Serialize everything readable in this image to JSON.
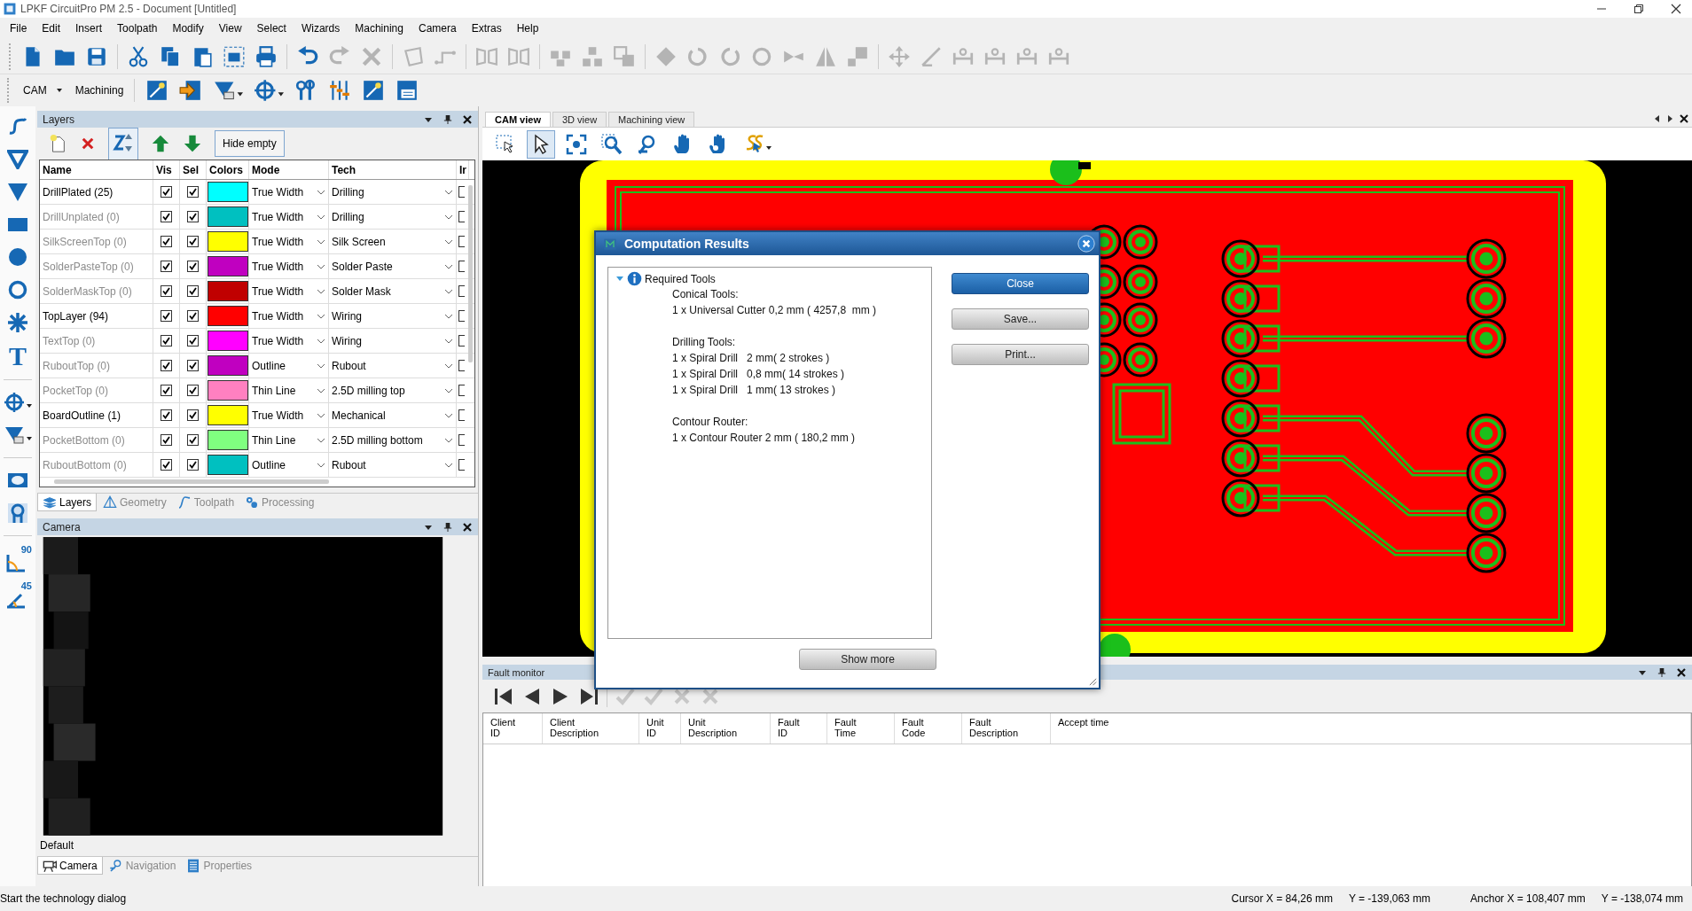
{
  "window": {
    "title": "LPKF CircuitPro PM 2.5 - Document [Untitled]"
  },
  "menu": [
    "File",
    "Edit",
    "Insert",
    "Toolpath",
    "Modify",
    "View",
    "Select",
    "Wizards",
    "Machining",
    "Camera",
    "Extras",
    "Help"
  ],
  "toolbar": [
    {
      "disabled": false
    },
    {
      "disabled": false
    },
    {
      "disabled": false
    },
    {
      "disabled": false
    },
    {
      "disabled": false
    },
    {
      "disabled": false
    },
    {
      "disabled": false
    },
    {
      "disabled": false
    },
    {
      "disabled": false
    },
    {
      "disabled": true
    },
    {
      "disabled": true
    },
    {
      "disabled": true
    },
    {
      "disabled": true
    },
    {
      "disabled": true
    },
    {
      "disabled": true
    },
    {
      "disabled": true
    },
    {
      "disabled": true
    },
    {
      "disabled": true
    },
    {
      "disabled": true
    },
    {
      "disabled": true
    },
    {
      "disabled": true
    },
    {
      "disabled": true
    },
    {
      "disabled": true
    },
    {
      "disabled": true
    },
    {
      "disabled": true
    },
    {
      "disabled": true
    },
    {
      "disabled": true
    },
    {
      "disabled": true
    },
    {
      "disabled": true
    },
    {
      "disabled": true
    },
    {
      "disabled": true
    }
  ],
  "toolbar2": {
    "mode": "CAM",
    "label": "Machining",
    "buttons": [
      {
        "disabled": false
      },
      {
        "disabled": false
      },
      {
        "disabled": false
      },
      {
        "disabled": false
      },
      {
        "disabled": false
      },
      {
        "disabled": false
      },
      {
        "disabled": false
      },
      {
        "disabled": false
      }
    ]
  },
  "tool_strip": {
    "text_glyph": "T",
    "angle_labels": [
      "90",
      "45"
    ]
  },
  "layers_panel": {
    "title": "Layers",
    "sort_active": true,
    "hide_empty": "Hide empty",
    "columns": [
      "Name",
      "Vis",
      "Sel",
      "Colors",
      "Mode",
      "Tech",
      "Ir"
    ],
    "rows": [
      {
        "name": "DrillPlated (25)",
        "empty": false,
        "vis": true,
        "sel": true,
        "color": "#00ffff",
        "mode": "True Width",
        "tech": "Drilling",
        "column_7": false
      },
      {
        "name": "DrillUnplated (0)",
        "empty": true,
        "vis": true,
        "sel": true,
        "color": "#00c0c0",
        "mode": "True Width",
        "tech": "Drilling",
        "column_7": false
      },
      {
        "name": "SilkScreenTop (0)",
        "empty": true,
        "vis": true,
        "sel": true,
        "color": "#ffff00",
        "mode": "True Width",
        "tech": "Silk Screen",
        "column_7": false
      },
      {
        "name": "SolderPasteTop (0)",
        "empty": true,
        "vis": true,
        "sel": true,
        "color": "#c000c0",
        "mode": "True Width",
        "tech": "Solder Paste",
        "column_7": false
      },
      {
        "name": "SolderMaskTop (0)",
        "empty": true,
        "vis": true,
        "sel": true,
        "color": "#c00000",
        "mode": "True Width",
        "tech": "Solder Mask",
        "column_7": false
      },
      {
        "name": "TopLayer (94)",
        "empty": false,
        "vis": true,
        "sel": true,
        "color": "#ff0000",
        "mode": "True Width",
        "tech": "Wiring",
        "column_7": false
      },
      {
        "name": "TextTop (0)",
        "empty": true,
        "vis": true,
        "sel": true,
        "color": "#ff00ff",
        "mode": "True Width",
        "tech": "Wiring",
        "column_7": false
      },
      {
        "name": "RuboutTop (0)",
        "empty": true,
        "vis": true,
        "sel": true,
        "color": "#c000c0",
        "mode": "Outline",
        "tech": "Rubout",
        "column_7": false
      },
      {
        "name": "PocketTop (0)",
        "empty": true,
        "vis": true,
        "sel": true,
        "color": "#ff80c0",
        "mode": "Thin Line",
        "tech": "2.5D milling top",
        "column_7": false
      },
      {
        "name": "BoardOutline (1)",
        "empty": false,
        "vis": true,
        "sel": true,
        "color": "#ffff00",
        "mode": "True Width",
        "tech": "Mechanical",
        "column_7": false
      },
      {
        "name": "PocketBottom (0)",
        "empty": true,
        "vis": true,
        "sel": true,
        "color": "#80ff80",
        "mode": "Thin Line",
        "tech": "2.5D milling bottom",
        "column_7": false
      },
      {
        "name": "RuboutBottom (0)",
        "empty": true,
        "vis": true,
        "sel": true,
        "color": "#00c0c0",
        "mode": "Outline",
        "tech": "Rubout",
        "column_7": false
      }
    ],
    "tabs": [
      {
        "label": "Layers",
        "selected": true
      },
      {
        "label": "Geometry",
        "selected": false
      },
      {
        "label": "Toolpath",
        "selected": false
      },
      {
        "label": "Processing",
        "selected": false
      }
    ]
  },
  "camera_panel": {
    "title": "Camera",
    "status": "Default",
    "tabs": [
      {
        "label": "Camera",
        "selected": true
      },
      {
        "label": "Navigation",
        "selected": false
      },
      {
        "label": "Properties",
        "selected": false
      }
    ]
  },
  "view_tabs": [
    {
      "label": "CAM view",
      "selected": true
    },
    {
      "label": "3D view",
      "selected": false
    },
    {
      "label": "Machining view",
      "selected": false
    }
  ],
  "view_toolbar": [
    {
      "selected": false
    },
    {
      "selected": true
    },
    {
      "selected": false
    },
    {
      "selected": false
    },
    {
      "selected": false
    },
    {
      "selected": false
    },
    {
      "selected": false
    },
    {
      "selected": false
    }
  ],
  "dialog": {
    "title": "Computation Results",
    "tree": {
      "label": "Required Tools",
      "expanded": true,
      "groups": [
        {
          "heading": "Conical Tools:",
          "items": [
            "1 x Universal Cutter 0,2 mm ( 4257,8  mm )"
          ]
        },
        {
          "heading": "Drilling Tools:",
          "items": [
            "1 x Spiral Drill   2 mm( 2 strokes )",
            "1 x Spiral Drill   0,8 mm( 14 strokes )",
            "1 x Spiral Drill   1 mm( 13 strokes )"
          ]
        },
        {
          "heading": "Contour Router:",
          "items": [
            "1 x Contour Router 2 mm ( 180,2 mm )"
          ]
        }
      ]
    },
    "buttons": [
      {
        "label": "Close",
        "kind": "primary"
      },
      {
        "label": "Save...",
        "kind": "normal"
      },
      {
        "label": "Print...",
        "kind": "normal"
      }
    ],
    "show_more": "Show more"
  },
  "fault_monitor": {
    "title": "Fault monitor",
    "toolbar": [
      {
        "disabled": false
      },
      {
        "disabled": false
      },
      {
        "disabled": false
      },
      {
        "disabled": false
      },
      {
        "disabled": true
      },
      {
        "disabled": true
      },
      {
        "disabled": true
      },
      {
        "disabled": true
      }
    ],
    "columns": [
      "Client ID",
      "Client Description",
      "Unit ID",
      "Unit Description",
      "Fault ID",
      "Fault Time",
      "Fault Code",
      "Fault Description",
      "Accept time"
    ]
  },
  "status_bar": {
    "message": "Start the technology dialog",
    "cursor_x": "Cursor X =  84,26 mm",
    "cursor_y": "Y =  -139,063 mm",
    "anchor_x": "Anchor X =  108,407 mm",
    "anchor_y": "Y =  -138,074 mm"
  }
}
